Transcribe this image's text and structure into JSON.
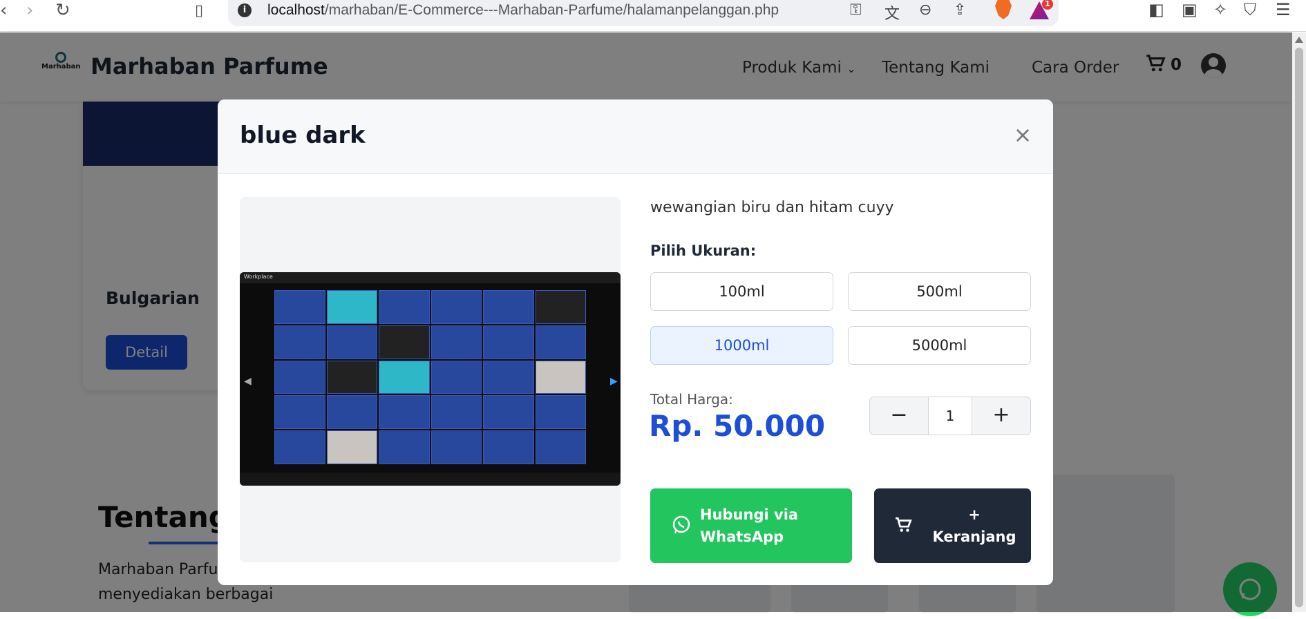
{
  "browser": {
    "url_host": "localhost",
    "url_path": "/marhaban/E-Commerce---Marhaban-Parfume/halamanpelanggan.php",
    "rewards_badge": "1"
  },
  "site": {
    "logo_text": "Marhaban",
    "brand": "Marhaban Parfume",
    "menu": {
      "produk": "Produk Kami",
      "tentang": "Tentang Kami",
      "cara_order": "Cara Order"
    },
    "cart_count": "0"
  },
  "card": {
    "title": "Bulgarian",
    "detail_button": "Detail"
  },
  "about": {
    "title": "Tentang",
    "text": "Marhaban Parfu... oleh Bapak Syarif Salim Bahanan. Kami menyediakan berbagai"
  },
  "modal": {
    "title": "blue dark",
    "close": "×",
    "description": "wewangian biru dan hitam cuyy",
    "size_label": "Pilih Ukuran:",
    "sizes": [
      {
        "label": "100ml",
        "active": false
      },
      {
        "label": "500ml",
        "active": false
      },
      {
        "label": "1000ml",
        "active": true
      },
      {
        "label": "5000ml",
        "active": false
      }
    ],
    "total_label": "Total Harga:",
    "total_value": "Rp. 50.000",
    "quantity": "1",
    "minus": "−",
    "plus": "+",
    "whatsapp_button": "Hubungi via WhatsApp",
    "cart_button_plus": "+",
    "cart_button_text": "Keranjang",
    "image_caption": "Workplace"
  },
  "colors": {
    "primary": "#1d4ed8",
    "whatsapp": "#22c55e",
    "dark": "#1f2937"
  }
}
